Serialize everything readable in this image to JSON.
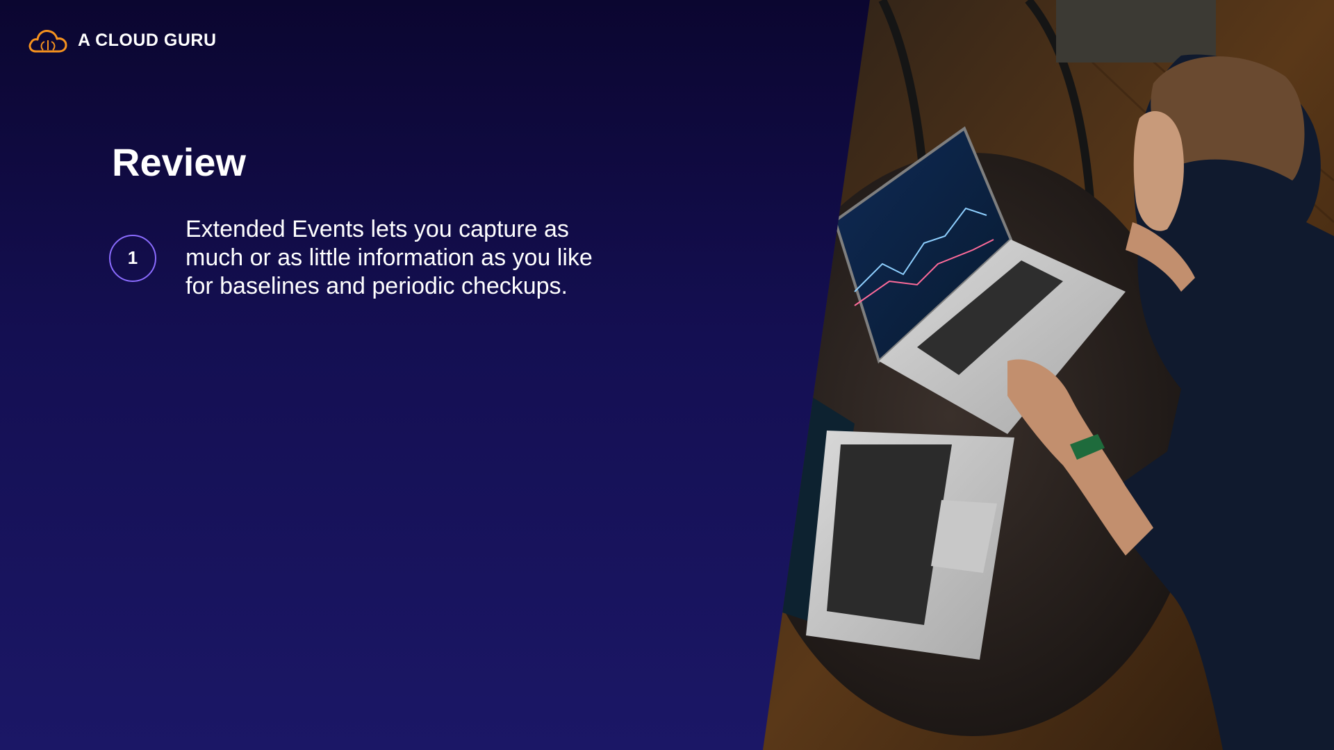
{
  "brand": {
    "name": "A CLOUD GURU",
    "logo_icon": "cloud-icon",
    "accent_color": "#f7931e"
  },
  "slide": {
    "title": "Review",
    "items": [
      {
        "number": "1",
        "text": "Extended Events lets you capture as much or as little information as you like for baselines and periodic checkups."
      }
    ]
  },
  "colors": {
    "background_top": "#0b0630",
    "background_bottom": "#1b1766",
    "badge_border": "#8b6cff"
  }
}
